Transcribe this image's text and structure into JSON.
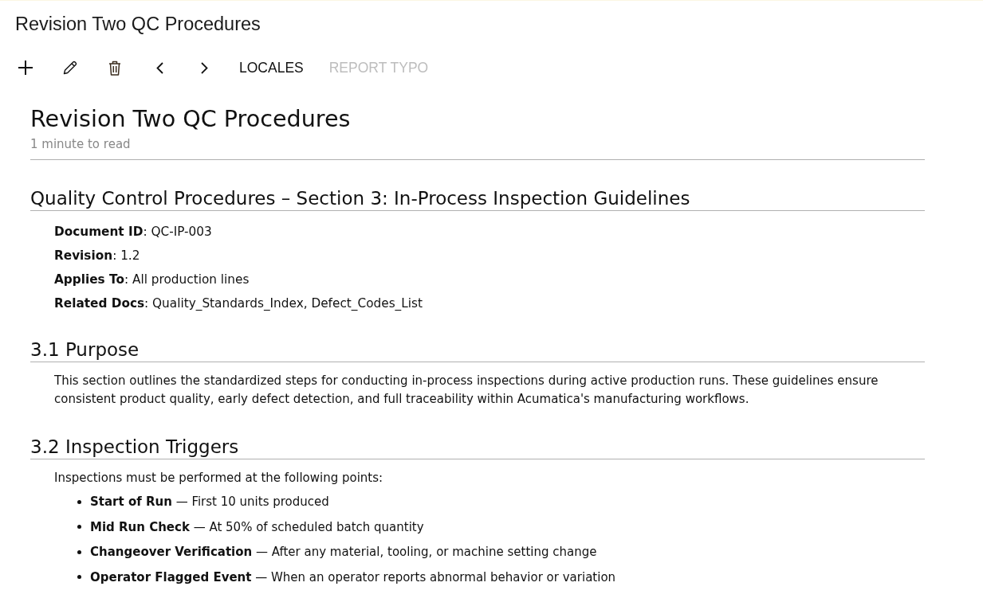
{
  "page_title": "Revision Two QC Procedures",
  "toolbar": {
    "text_buttons": [
      {
        "label": "LOCALES",
        "disabled": false
      },
      {
        "label": "REPORT TYPO",
        "disabled": true
      }
    ]
  },
  "article": {
    "title": "Revision Two QC Procedures",
    "read_time": "1 minute to read",
    "sections": [
      {
        "heading": "Quality Control Procedures – Section 3: In-Process Inspection Guidelines",
        "blocks": [
          {
            "kind": "fields",
            "items": [
              "**Document ID**: QC-IP-003",
              "**Revision**: 1.2",
              "**Applies To**: All production lines",
              "**Related Docs**: Quality_Standards_Index, Defect_Codes_List"
            ]
          }
        ]
      },
      {
        "heading": "3.1 Purpose",
        "blocks": [
          {
            "kind": "paragraph",
            "text": "This section outlines the standardized steps for conducting in-process inspections during active production runs. These guidelines ensure consistent product quality, early defect detection, and full traceability within Acumatica's manufacturing workflows."
          }
        ]
      },
      {
        "heading": "3.2 Inspection Triggers",
        "blocks": [
          {
            "kind": "paragraph",
            "text": "Inspections must be performed at the following points:"
          },
          {
            "kind": "bullets",
            "items": [
              "**Start of Run** — First 10 units produced",
              "**Mid Run Check** — At 50% of scheduled batch quantity",
              "**Changeover Verification** — After any material, tooling, or machine setting change",
              "**Operator Flagged Event** — When an operator reports abnormal behavior or variation"
            ]
          }
        ]
      }
    ]
  }
}
